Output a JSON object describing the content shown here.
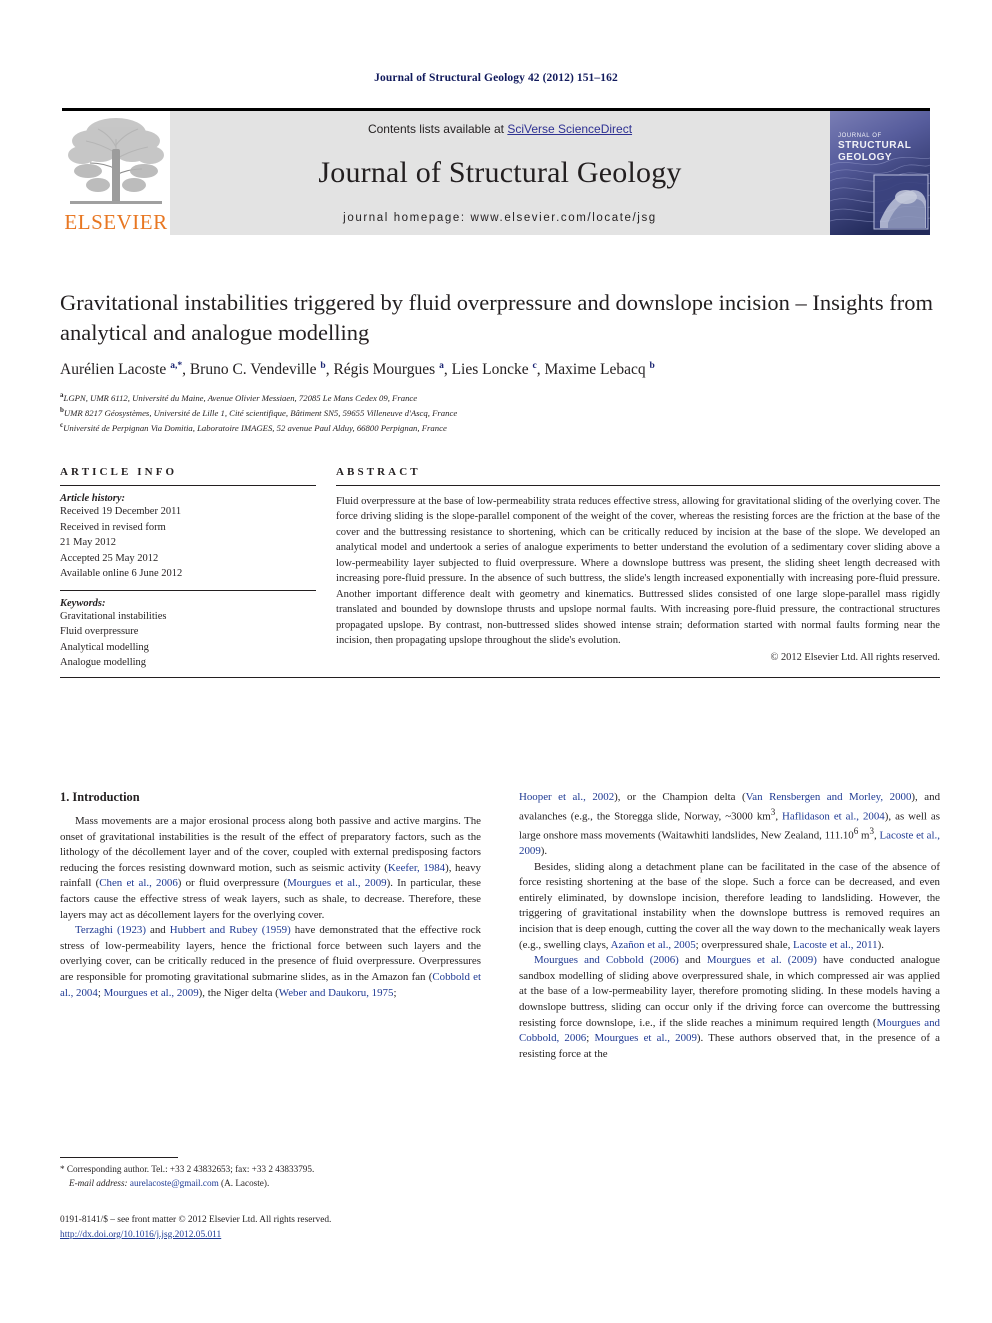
{
  "running_head": "Journal of Structural Geology 42 (2012) 151–162",
  "masthead": {
    "publisher_name": "ELSEVIER",
    "contents_prefix": "Contents lists available at ",
    "contents_link": "SciVerse ScienceDirect",
    "journal_name": "Journal of Structural Geology",
    "homepage_prefix": "journal homepage: ",
    "homepage_url": "www.elsevier.com/locate/jsg",
    "cover": {
      "line1": "JOURNAL OF",
      "line2": "STRUCTURAL",
      "line3": "GEOLOGY"
    }
  },
  "article": {
    "title": "Gravitational instabilities triggered by fluid overpressure and downslope incision – Insights from analytical and analogue modelling",
    "authors_html": "Aurélien Lacoste <sup>a,*</sup>, Bruno C. Vendeville <sup>b</sup>, Régis Mourgues <sup>a</sup>, Lies Loncke <sup>c</sup>, Maxime Lebacq <sup>b</sup>",
    "affiliations": [
      "LGPN, UMR 6112, Université du Maine, Avenue Olivier Messiaen, 72085 Le Mans Cedex 09, France",
      "UMR 8217 Géosystèmes, Université de Lille 1, Cité scientifique, Bâtiment SN5, 59655 Villeneuve d'Ascq, France",
      "Université de Perpignan Via Domitia, Laboratoire IMAGES, 52 avenue Paul Alduy, 66800 Perpignan, France"
    ],
    "affiliation_marks": [
      "a",
      "b",
      "c"
    ]
  },
  "article_info": {
    "heading": "ARTICLE INFO",
    "history_label": "Article history:",
    "history_lines": [
      "Received 19 December 2011",
      "Received in revised form",
      "21 May 2012",
      "Accepted 25 May 2012",
      "Available online 6 June 2012"
    ],
    "keywords_label": "Keywords:",
    "keywords": [
      "Gravitational instabilities",
      "Fluid overpressure",
      "Analytical modelling",
      "Analogue modelling"
    ]
  },
  "abstract": {
    "heading": "ABSTRACT",
    "text": "Fluid overpressure at the base of low-permeability strata reduces effective stress, allowing for gravitational sliding of the overlying cover. The force driving sliding is the slope-parallel component of the weight of the cover, whereas the resisting forces are the friction at the base of the cover and the buttressing resistance to shortening, which can be critically reduced by incision at the base of the slope. We developed an analytical model and undertook a series of analogue experiments to better understand the evolution of a sedimentary cover sliding above a low-permeability layer subjected to fluid overpressure. Where a downslope buttress was present, the sliding sheet length decreased with increasing pore-fluid pressure. In the absence of such buttress, the slide's length increased exponentially with increasing pore-fluid pressure. Another important difference dealt with geometry and kinematics. Buttressed slides consisted of one large slope-parallel mass rigidly translated and bounded by downslope thrusts and upslope normal faults. With increasing pore-fluid pressure, the contractional structures propagated upslope. By contrast, non-buttressed slides showed intense strain; deformation started with normal faults forming near the incision, then propagating upslope throughout the slide's evolution.",
    "copyright": "© 2012 Elsevier Ltd. All rights reserved."
  },
  "introduction": {
    "heading": "1.  Introduction",
    "left_paragraphs": [
      "Mass movements are a major erosional process along both passive and active margins. The onset of gravitational instabilities is the result of the effect of preparatory factors, such as the lithology of the décollement layer and of the cover, coupled with external predisposing factors reducing the forces resisting downward motion, such as seismic activity (<a class=\"cite\">Keefer, 1984</a>), heavy rainfall (<a class=\"cite\">Chen et al., 2006</a>) or fluid overpressure (<a class=\"cite\">Mourgues et al., 2009</a>). In particular, these factors cause the effective stress of weak layers, such as shale, to decrease. Therefore, these layers may act as décollement layers for the overlying cover.",
      "<a class=\"cite\">Terzaghi (1923)</a> and <a class=\"cite\">Hubbert and Rubey (1959)</a> have demonstrated that the effective rock stress of low-permeability layers, hence the frictional force between such layers and the overlying cover, can be critically reduced in the presence of fluid overpressure. Overpressures are responsible for promoting gravitational submarine slides, as in the Amazon fan (<a class=\"cite\">Cobbold et al., 2004</a>; <a class=\"cite\">Mourgues et al., 2009</a>), the Niger delta (<a class=\"cite\">Weber and Daukoru, 1975</a>;"
    ],
    "right_paragraphs": [
      "<a class=\"cite\">Hooper et al., 2002</a>), or the Champion delta (<a class=\"cite\">Van Rensbergen and Morley, 2000</a>), and avalanches (e.g., the Storegga slide, Norway, ~3000 km<sup>3</sup>, <a class=\"cite\">Haflidason et al., 2004</a>), as well as large onshore mass movements (Waitawhiti landslides, New Zealand, 111.10<sup>6</sup> m<sup>3</sup>, <a class=\"cite\">Lacoste et al., 2009</a>).",
      "Besides, sliding along a detachment plane can be facilitated in the case of the absence of force resisting shortening at the base of the slope. Such a force can be decreased, and even entirely eliminated, by downslope incision, therefore leading to landsliding. However, the triggering of gravitational instability when the downslope buttress is removed requires an incision that is deep enough, cutting the cover all the way down to the mechanically weak layers (e.g., swelling clays, <a class=\"cite\">Azañon et al., 2005</a>; overpressured shale, <a class=\"cite\">Lacoste et al., 2011</a>).",
      "<a class=\"cite\">Mourgues and Cobbold (2006)</a> and <a class=\"cite\">Mourgues et al. (2009)</a> have conducted analogue sandbox modelling of sliding above overpressured shale, in which compressed air was applied at the base of a low-permeability layer, therefore promoting sliding. In these models having a downslope buttress, sliding can occur only if the driving force can overcome the buttressing resisting force downslope, i.e., if the slide reaches a minimum required length (<a class=\"cite\">Mourgues and Cobbold, 2006</a>; <a class=\"cite\">Mourgues et al., 2009</a>). These authors observed that, in the presence of a resisting force at the"
    ]
  },
  "footnotes": {
    "corresponding_html": "* Corresponding author. Tel.: +33 2 43832653; fax: +33 2 43833795.",
    "email_label": "E-mail address:",
    "email": "aurelacoste@gmail.com",
    "email_owner": "(A. Lacoste)."
  },
  "imprint": {
    "issn_line": "0191-8141/$ – see front matter © 2012 Elsevier Ltd. All rights reserved.",
    "doi": "http://dx.doi.org/10.1016/j.jsg.2012.05.011"
  },
  "colors": {
    "elsevier_orange": "#e87722",
    "link_blue": "#1f3a93",
    "running_head_blue": "#111a5c",
    "masthead_grey": "#e3e3e3",
    "text_black": "#231f20"
  }
}
